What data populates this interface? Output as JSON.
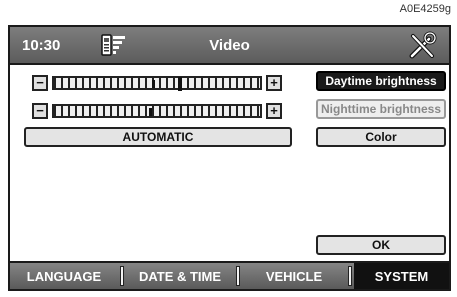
{
  "figure_ref": "A0E4259g",
  "header": {
    "time": "10:30",
    "title": "Video"
  },
  "controls": {
    "automatic_label": "AUTOMATIC",
    "slider_a_level": 0.6,
    "slider_b_level": 0.46
  },
  "side_buttons": [
    {
      "label": "Daytime brightness",
      "state": "selected"
    },
    {
      "label": "Nighttime brightness",
      "state": "disabled"
    },
    {
      "label": "Color",
      "state": "normal"
    }
  ],
  "ok_label": "OK",
  "tabs": [
    {
      "label": "LANGUAGE"
    },
    {
      "label": "DATE & TIME"
    },
    {
      "label": "VEHICLE"
    },
    {
      "label": "SYSTEM",
      "active": true
    }
  ],
  "icons": [
    "phone-signal-icon",
    "tools-icon"
  ]
}
